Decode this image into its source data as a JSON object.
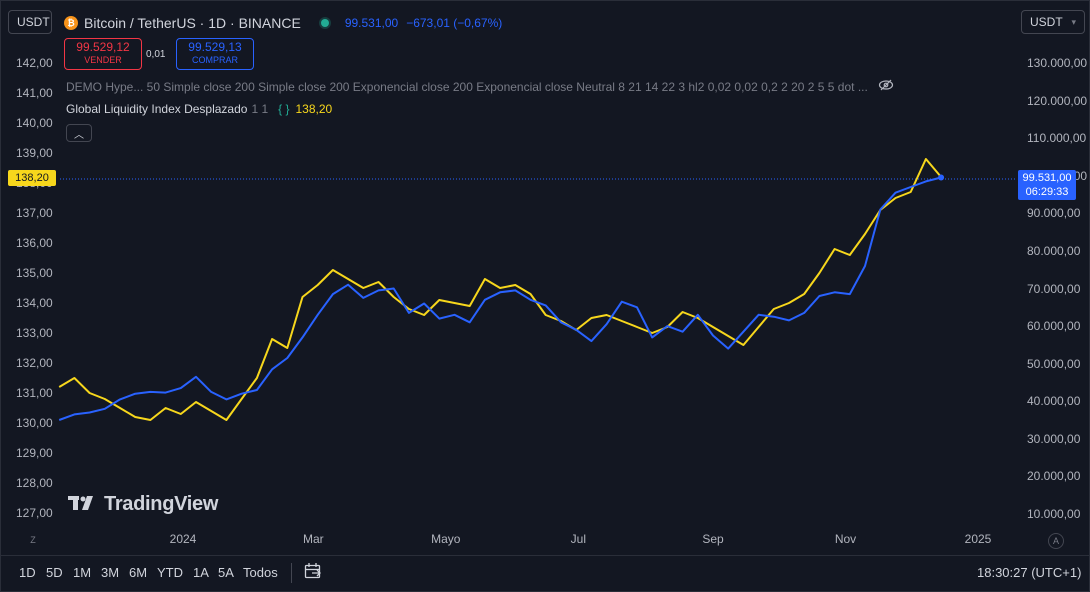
{
  "header": {
    "unit_left": "USDT",
    "unit_right": "USDT",
    "symbol": "Bitcoin / TetherUS · 1D · BINANCE",
    "price": "99.531,00",
    "change": "−673,01 (−0,67%)",
    "sell_price": "99.529,12",
    "sell_label": "VENDER",
    "spread": "0,01",
    "buy_price": "99.529,13",
    "buy_label": "COMPRAR",
    "indicators": "DEMO Hype...  50 Simple close 200 Simple close 200 Exponencial close 200 Exponencial close Neutral 8 21 14 22 3 hl2 0,02 0,02 0,2 2 20 2 5 5 dot ...",
    "gli_name": "Global Liquidity Index Desplazado",
    "gli_params": "1 1",
    "gli_value": "138,20",
    "watermark": "TradingView"
  },
  "tags": {
    "left_value": "138,20",
    "right_value": "99.531,00",
    "right_countdown": "06:29:33"
  },
  "bottom": {
    "ranges": [
      "1D",
      "5D",
      "1M",
      "3M",
      "6M",
      "YTD",
      "1A",
      "5A",
      "Todos"
    ],
    "clock": "18:30:27 (UTC+1)",
    "z_label": "Z",
    "a_label": "A"
  },
  "colors": {
    "background": "#131722",
    "gli_line": "#f7d71c",
    "btc_line": "#2962ff",
    "sell": "#f23645",
    "buy": "#2962ff"
  },
  "icons": {
    "eye": "eye-crossed-icon",
    "calendar": "date-range-icon",
    "logo": "tradingview-logo-icon",
    "btc": "bitcoin-logo-icon"
  },
  "chart_data": {
    "type": "line",
    "x_ticks": [
      "2024",
      "Mar",
      "Mayo",
      "Jul",
      "Sep",
      "Nov",
      "2025"
    ],
    "y_left": {
      "label": "Global Liquidity Index",
      "ticks": [
        "142,00",
        "141,00",
        "140,00",
        "139,00",
        "138,00",
        "137,00",
        "136,00",
        "135,00",
        "134,00",
        "133,00",
        "132,00",
        "131,00",
        "130,00",
        "129,00",
        "128,00",
        "127,00"
      ],
      "range": [
        126.6,
        142.3
      ]
    },
    "y_right": {
      "label": "USDT",
      "ticks": [
        "130.000,00",
        "120.000,00",
        "110.000,00",
        "100.000,00",
        "90.000,00",
        "80.000,00",
        "70.000,00",
        "60.000,00",
        "50.000,00",
        "40.000,00",
        "30.000,00",
        "20.000,00",
        "10.000,00"
      ],
      "range": [
        8000,
        132000
      ]
    },
    "series": [
      {
        "name": "Global Liquidity Index Desplazado",
        "axis": "left",
        "x": [
          "2023-11-05",
          "2023-11-12",
          "2023-11-19",
          "2023-11-26",
          "2023-12-03",
          "2023-12-10",
          "2023-12-17",
          "2023-12-24",
          "2023-12-31",
          "2024-01-07",
          "2024-01-14",
          "2024-01-21",
          "2024-01-28",
          "2024-02-04",
          "2024-02-11",
          "2024-02-18",
          "2024-02-25",
          "2024-03-03",
          "2024-03-10",
          "2024-03-17",
          "2024-03-24",
          "2024-03-31",
          "2024-04-07",
          "2024-04-14",
          "2024-04-21",
          "2024-04-28",
          "2024-05-05",
          "2024-05-12",
          "2024-05-19",
          "2024-05-26",
          "2024-06-02",
          "2024-06-09",
          "2024-06-16",
          "2024-06-23",
          "2024-06-30",
          "2024-07-07",
          "2024-07-14",
          "2024-07-21",
          "2024-07-28",
          "2024-08-04",
          "2024-08-11",
          "2024-08-18",
          "2024-08-25",
          "2024-09-01",
          "2024-09-08",
          "2024-09-15",
          "2024-09-22",
          "2024-09-29",
          "2024-10-06",
          "2024-10-13",
          "2024-10-20",
          "2024-10-27",
          "2024-11-03",
          "2024-11-10",
          "2024-11-17",
          "2024-11-24",
          "2024-12-01",
          "2024-12-08",
          "2024-12-15"
        ],
        "values": [
          131.2,
          131.5,
          131.0,
          130.8,
          130.5,
          130.2,
          130.1,
          130.5,
          130.3,
          130.7,
          130.4,
          130.1,
          130.8,
          131.5,
          132.8,
          132.5,
          134.2,
          134.6,
          135.1,
          134.8,
          134.5,
          134.7,
          134.2,
          133.8,
          133.6,
          134.1,
          134.0,
          133.9,
          134.8,
          134.5,
          134.6,
          134.3,
          133.6,
          133.4,
          133.1,
          133.5,
          133.6,
          133.4,
          133.2,
          133.0,
          133.2,
          133.7,
          133.5,
          133.2,
          132.9,
          132.6,
          133.2,
          133.8,
          134.0,
          134.3,
          135.0,
          135.8,
          135.6,
          136.3,
          137.1,
          137.5,
          137.7,
          138.8,
          138.2
        ]
      },
      {
        "name": "Bitcoin / TetherUS",
        "axis": "right",
        "x": [
          "2023-11-05",
          "2023-11-12",
          "2023-11-19",
          "2023-11-26",
          "2023-12-03",
          "2023-12-10",
          "2023-12-17",
          "2023-12-24",
          "2023-12-31",
          "2024-01-07",
          "2024-01-14",
          "2024-01-21",
          "2024-01-28",
          "2024-02-04",
          "2024-02-11",
          "2024-02-18",
          "2024-02-25",
          "2024-03-03",
          "2024-03-10",
          "2024-03-17",
          "2024-03-24",
          "2024-03-31",
          "2024-04-07",
          "2024-04-14",
          "2024-04-21",
          "2024-04-28",
          "2024-05-05",
          "2024-05-12",
          "2024-05-19",
          "2024-05-26",
          "2024-06-02",
          "2024-06-09",
          "2024-06-16",
          "2024-06-23",
          "2024-06-30",
          "2024-07-07",
          "2024-07-14",
          "2024-07-21",
          "2024-07-28",
          "2024-08-04",
          "2024-08-11",
          "2024-08-18",
          "2024-08-25",
          "2024-09-01",
          "2024-09-08",
          "2024-09-15",
          "2024-09-22",
          "2024-09-29",
          "2024-10-06",
          "2024-10-13",
          "2024-10-20",
          "2024-10-27",
          "2024-11-03",
          "2024-11-10",
          "2024-11-17",
          "2024-11-24",
          "2024-12-01",
          "2024-12-08",
          "2024-12-15"
        ],
        "values": [
          35000,
          36500,
          37000,
          38000,
          40500,
          42000,
          42500,
          42300,
          43500,
          46500,
          42500,
          40500,
          42000,
          43000,
          48500,
          51500,
          57000,
          63000,
          68500,
          71000,
          67500,
          69500,
          70000,
          63500,
          66000,
          62000,
          63000,
          61000,
          67000,
          69000,
          69500,
          67000,
          65500,
          61000,
          59000,
          56000,
          60500,
          66500,
          65000,
          57000,
          60000,
          58500,
          63000,
          57500,
          54000,
          58500,
          63000,
          62500,
          61500,
          63500,
          68000,
          69000,
          68500,
          76000,
          91000,
          95500,
          97000,
          98500,
          99531
        ]
      }
    ]
  }
}
